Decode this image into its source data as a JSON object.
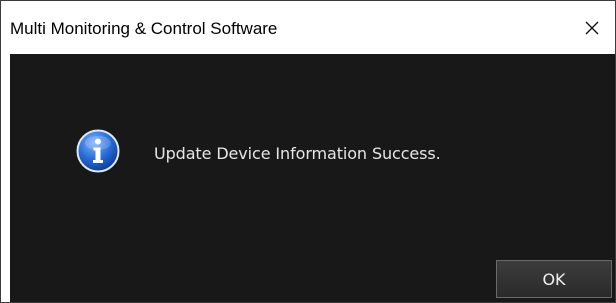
{
  "window": {
    "title": "Multi Monitoring & Control Software",
    "close_icon": "close-icon"
  },
  "dialog": {
    "icon": "info-icon",
    "message": "Update Device Information Success.",
    "ok_label": "OK"
  },
  "colors": {
    "content_background": "#181818",
    "message_text": "#e6e6e6",
    "icon_blue": "#1f5fc8",
    "button_background": "#333333",
    "button_border": "#6a6a6a"
  }
}
